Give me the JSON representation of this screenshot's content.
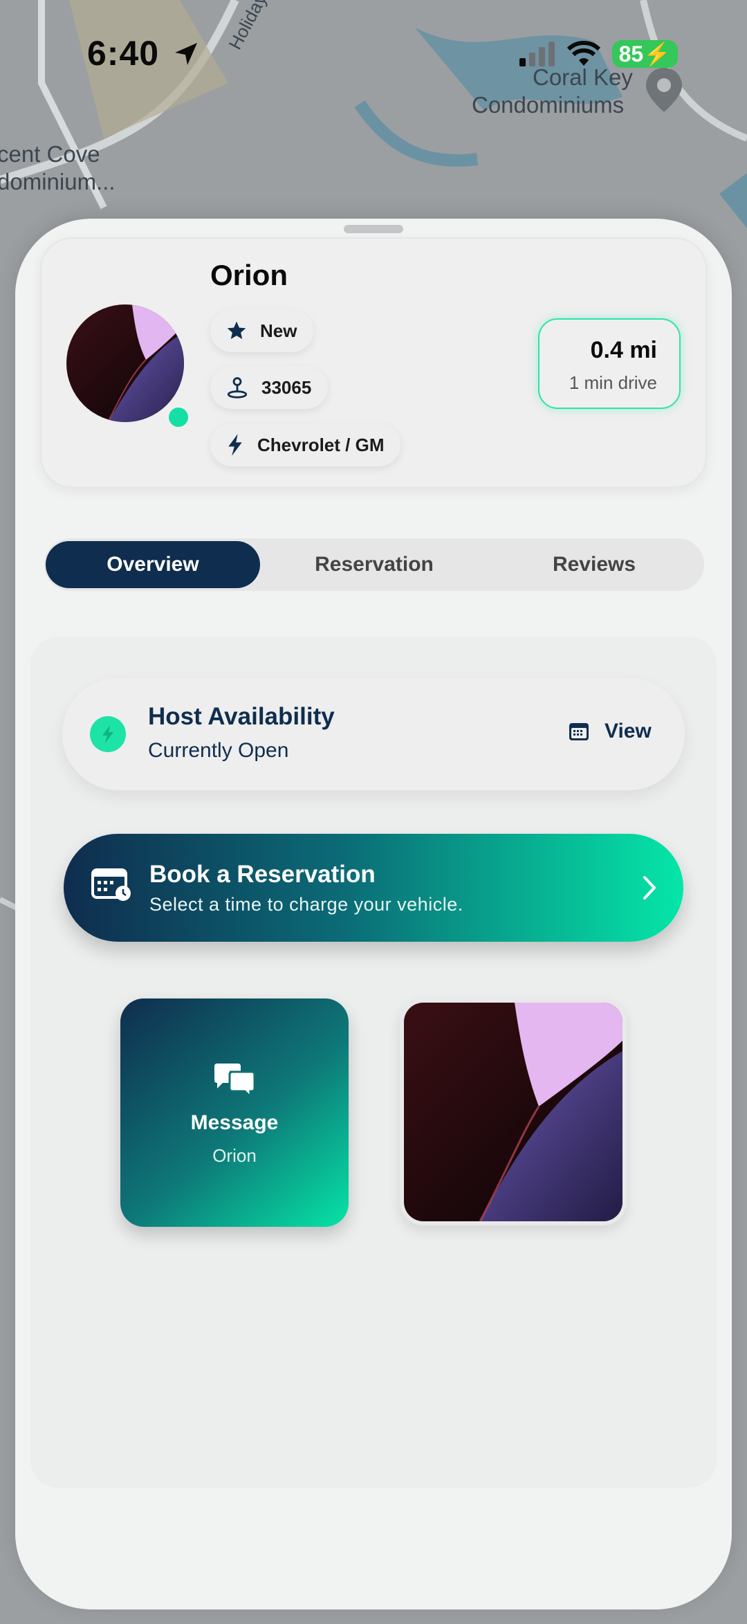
{
  "status_bar": {
    "time": "6:40",
    "battery": "85"
  },
  "map": {
    "labels": [
      "Coral Key",
      "Condominiums",
      "cent Cove",
      "dominium...",
      "Holiday Sp"
    ]
  },
  "host": {
    "name": "Orion",
    "rating_chip": "New",
    "zip_chip": "33065",
    "network_chip": "Chevrolet / GM",
    "distance": "0.4 mi",
    "drive_time": "1 min drive",
    "online_color": "#16dfa6"
  },
  "tabs": [
    {
      "label": "Overview",
      "active": true
    },
    {
      "label": "Reservation",
      "active": false
    },
    {
      "label": "Reviews",
      "active": false
    }
  ],
  "availability": {
    "title": "Host Availability",
    "status": "Currently Open",
    "action": "View"
  },
  "booking": {
    "title": "Book a Reservation",
    "subtitle": "Select a time to charge your vehicle."
  },
  "message_tile": {
    "title": "Message",
    "subtitle": "Orion"
  },
  "colors": {
    "navy": "#0f2d4e",
    "accent": "#1de3a6"
  }
}
